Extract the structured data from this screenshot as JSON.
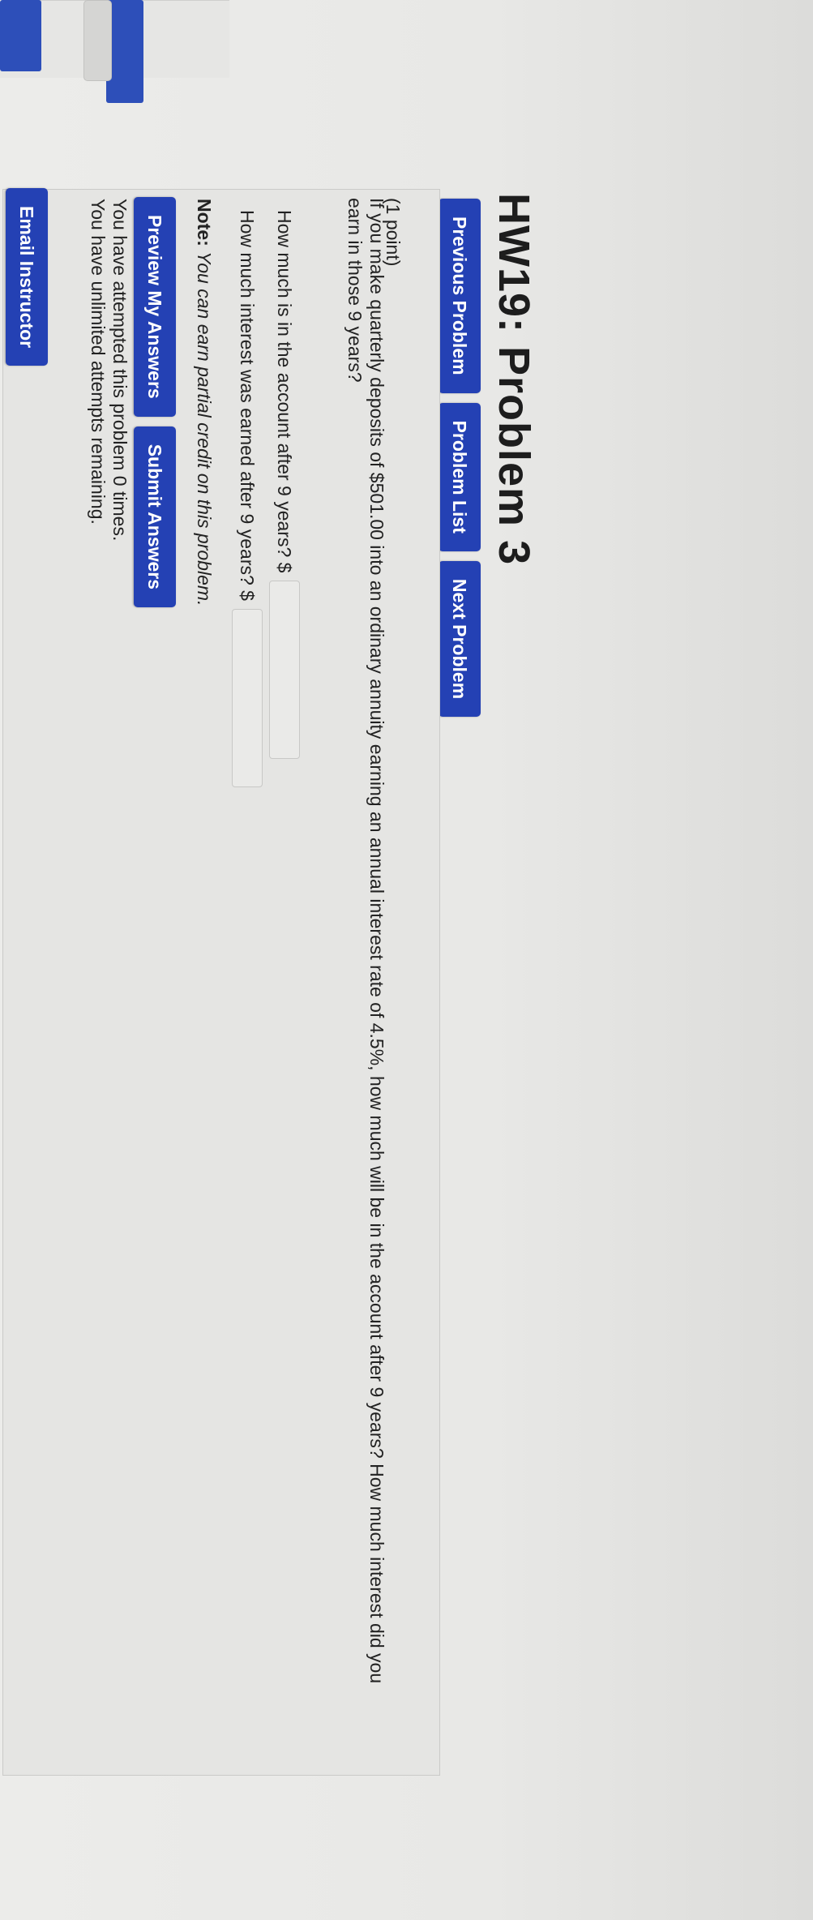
{
  "page": {
    "title": "HW19: Problem 3"
  },
  "nav": {
    "previous": "Previous Problem",
    "list": "Problem List",
    "next": "Next Problem"
  },
  "problem": {
    "points": "(1 point)",
    "text": "If you make quarterly deposits of $501.00 into an ordinary annuity earning an annual interest rate of 4.5%, how much will be in the account after 9 years? How much interest did you earn in those 9 years?",
    "q1_label": "How much is in the account after 9 years? $",
    "q1_value": "",
    "q2_label": "How much interest was earned after 9 years? $",
    "q2_value": ""
  },
  "note": {
    "label": "Note:",
    "text": "You can earn partial credit on this problem."
  },
  "actions": {
    "preview": "Preview My Answers",
    "submit": "Submit Answers"
  },
  "attempts": {
    "line1": "You have attempted this problem 0 times.",
    "line2": "You have unlimited attempts remaining."
  },
  "footer": {
    "email": "Email Instructor"
  },
  "icons": {
    "pointer": "pointing-hand-icon"
  },
  "colors": {
    "button": "#2441b4",
    "background": "#e7e7e5"
  }
}
